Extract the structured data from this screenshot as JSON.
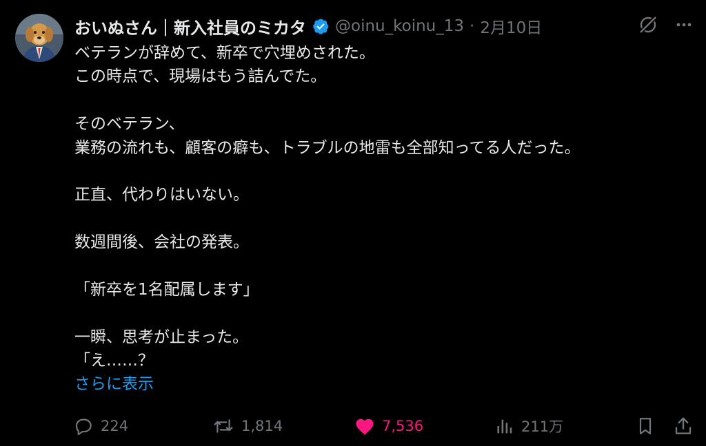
{
  "author": {
    "display_name": "おいぬさん｜新入社員のミカタ",
    "handle": "@oinu_koinu_13",
    "separator": "·",
    "date": "2月10日",
    "verified": true
  },
  "post": {
    "lines": [
      "ベテランが辞めて、新卒で穴埋めされた。",
      "この時点で、現場はもう詰んでた。",
      "",
      "そのベテラン、",
      "業務の流れも、顧客の癖も、トラブルの地雷も全部知ってる人だった。",
      "",
      "正直、代わりはいない。",
      "",
      "数週間後、会社の発表。",
      "",
      "「新卒を1名配属します」",
      "",
      "一瞬、思考が止まった。",
      "「え……？"
    ],
    "show_more": "さらに表示"
  },
  "actions": {
    "replies": "224",
    "reposts": "1,814",
    "likes": "7,536",
    "views": "211万",
    "liked": true
  },
  "icons": {
    "header": [
      "grok-icon",
      "more-icon"
    ],
    "actions": [
      "reply-icon",
      "repost-icon",
      "heart-icon",
      "views-icon",
      "bookmark-icon",
      "share-icon"
    ]
  },
  "colors": {
    "background": "#000000",
    "text": "#e7e9ea",
    "secondary": "#71767b",
    "link": "#1d9bf0",
    "like": "#f91880",
    "verified": "#1d9bf0"
  }
}
